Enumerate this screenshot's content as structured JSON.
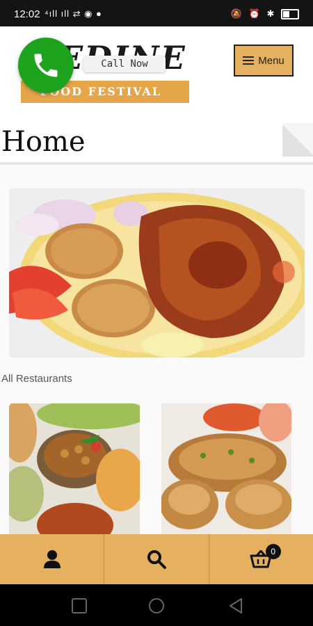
{
  "status": {
    "time": "12:02",
    "left_icons": "⁴ıll ıll ⇄ ◉ ●",
    "right_icons": "🔕 ⏰ ✱"
  },
  "header": {
    "logo_text": "NEDINE",
    "logo_subtitle": "FOOD FESTIVAL",
    "menu_label": "Menu"
  },
  "call": {
    "label": "Call Now"
  },
  "page": {
    "title": "Home"
  },
  "section": {
    "label": "All Restaurants"
  },
  "cart": {
    "count": "0"
  },
  "colors": {
    "accent": "#e5b060",
    "call_green": "#1ea31e"
  },
  "icons": {
    "user": "user-icon",
    "search": "search-icon",
    "cart": "cart-icon",
    "phone": "phone-icon"
  }
}
